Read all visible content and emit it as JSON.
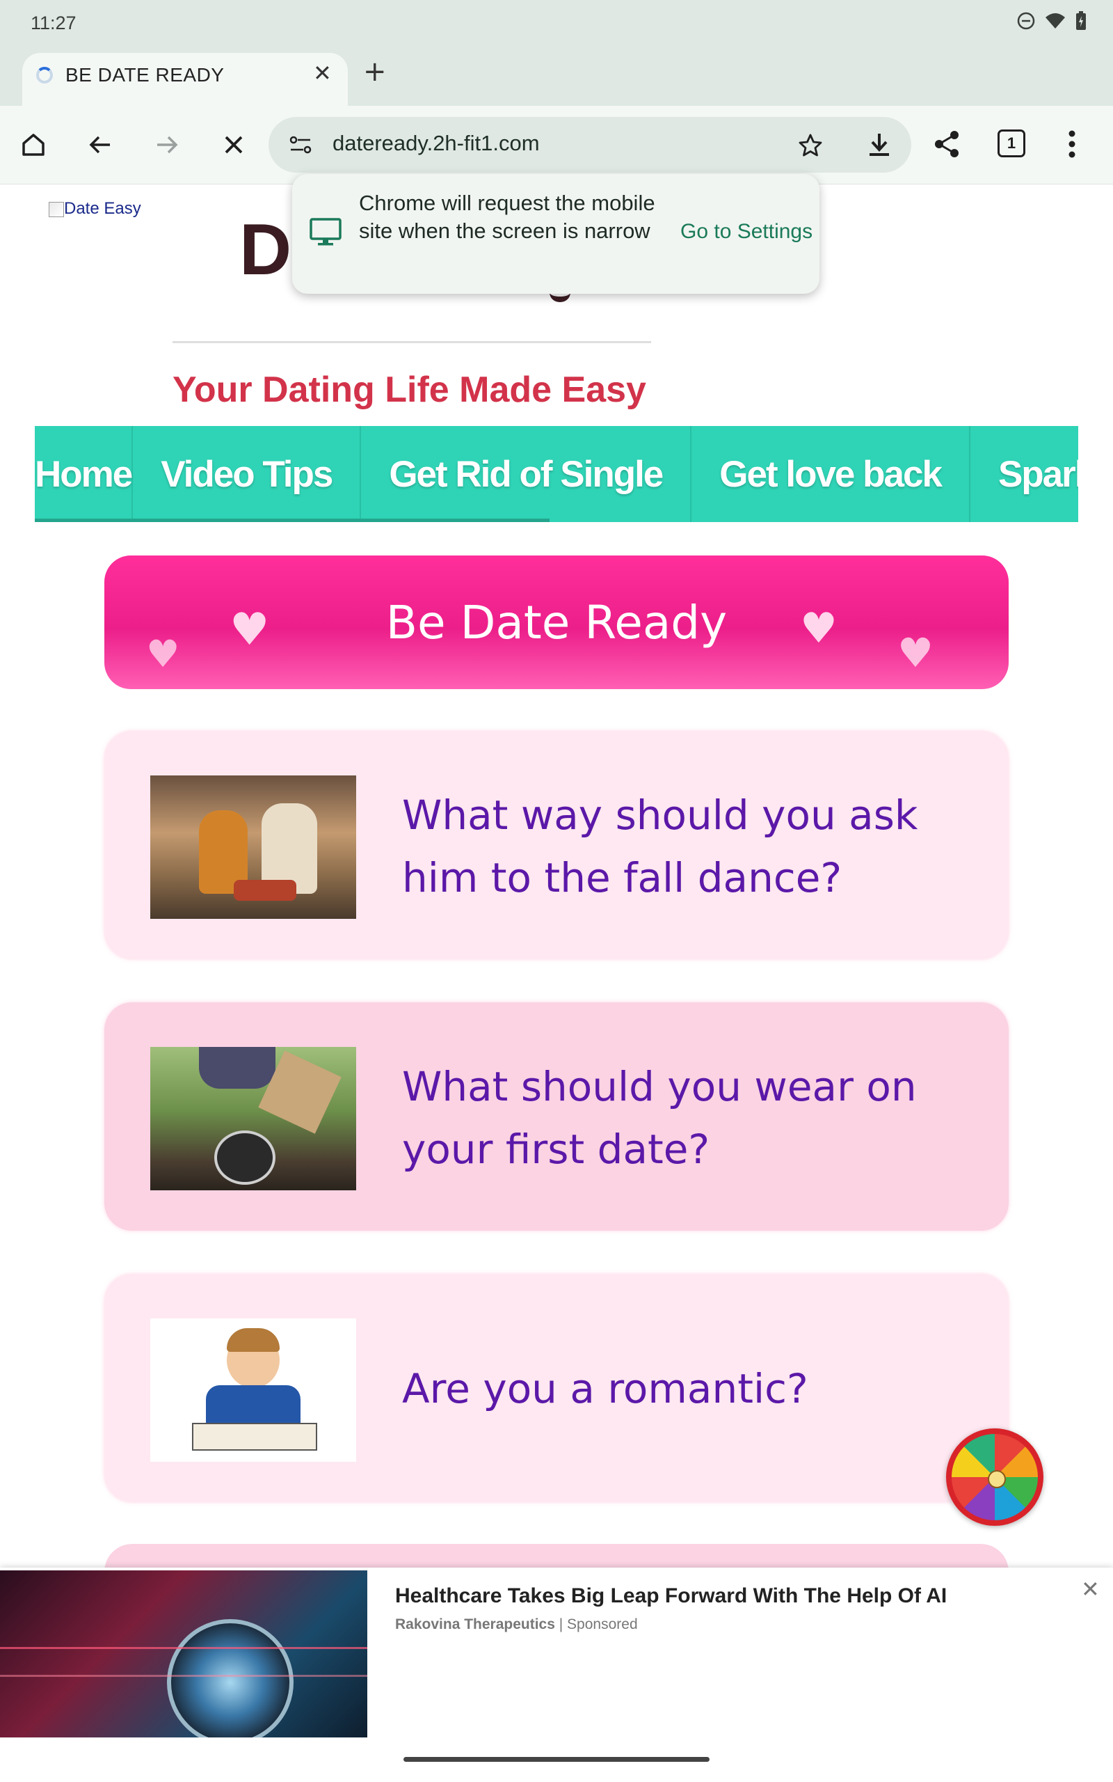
{
  "status": {
    "time": "11:27"
  },
  "tab": {
    "title": "BE DATE READY"
  },
  "toolbar": {
    "url": "dateready.2h-fit1.com",
    "tab_count": "1"
  },
  "popup": {
    "message": "Chrome will request the mobile site when the screen is narrow",
    "action": "Go to Settings"
  },
  "page": {
    "logo_alt": "Date Easy",
    "title_letter": "D",
    "tagline": "Your Dating Life Made Easy",
    "nav": [
      "Home",
      "Video Tips",
      "Get Rid of Single",
      "Get love back",
      "Spark"
    ],
    "banner_title": "Be Date Ready",
    "cards": [
      {
        "title": "What way should you ask him to the fall dance?"
      },
      {
        "title": "What should you wear on your first date?"
      },
      {
        "title": "Are you a romantic?"
      }
    ]
  },
  "ad": {
    "title": "Healthcare Takes Big Leap Forward With The Help Of AI",
    "advertiser": "Rakovina Therapeutics",
    "label": "Sponsored"
  },
  "colors": {
    "accent_teal": "#2fd3b5",
    "tagline_red": "#d2334a",
    "banner_pink": "#ec1f8a",
    "card_text_purple": "#5b18a8"
  }
}
